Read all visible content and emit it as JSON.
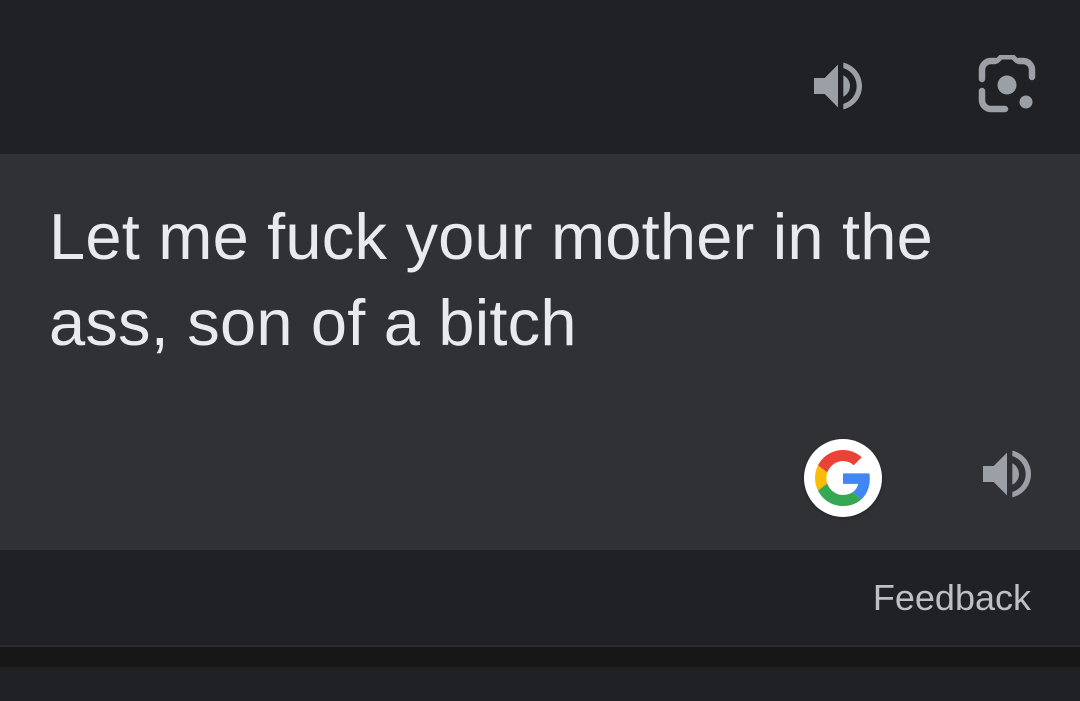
{
  "top_bar": {
    "speak_icon": "volume-up-icon",
    "lens_icon": "google-lens-icon"
  },
  "result": {
    "text": "Let me fuck your mother in the ass, son of a bitch",
    "google_icon": "google-g-icon",
    "speak_icon": "volume-up-icon"
  },
  "footer": {
    "feedback_label": "Feedback"
  },
  "colors": {
    "background": "#202124",
    "card": "#303134",
    "text": "#e8eaed",
    "icon": "#9aa0a6",
    "secondary_text": "#bdc1c6"
  }
}
